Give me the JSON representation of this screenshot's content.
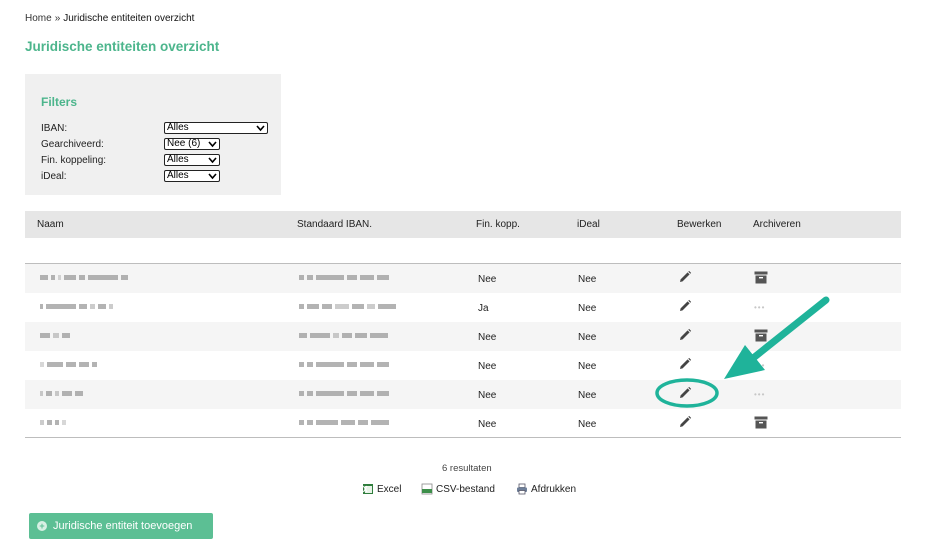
{
  "breadcrumb": {
    "home": "Home",
    "separator": "»",
    "current": "Juridische entiteiten overzicht"
  },
  "page_title": "Juridische entiteiten overzicht",
  "filters": {
    "title": "Filters",
    "items": [
      {
        "label": "IBAN:",
        "value": "Alles"
      },
      {
        "label": "Gearchiveerd:",
        "value": "Nee (6)"
      },
      {
        "label": "Fin. koppeling:",
        "value": "Alles"
      },
      {
        "label": "iDeal:",
        "value": "Alles"
      }
    ]
  },
  "table": {
    "headers": [
      "Naam",
      "Standaard IBAN.",
      "Fin. kopp.",
      "iDeal",
      "Bewerken",
      "Archiveren"
    ],
    "rows": [
      {
        "fin": "Nee",
        "ideal": "Nee",
        "archive": "archive-icon"
      },
      {
        "fin": "Ja",
        "ideal": "Nee",
        "archive": "dots"
      },
      {
        "fin": "Nee",
        "ideal": "Nee",
        "archive": "archive-icon"
      },
      {
        "fin": "Nee",
        "ideal": "Nee",
        "archive": "dots"
      },
      {
        "fin": "Nee",
        "ideal": "Nee",
        "archive": "dots"
      },
      {
        "fin": "Nee",
        "ideal": "Nee",
        "archive": "archive-icon"
      }
    ]
  },
  "results": "6 resultaten",
  "exports": {
    "excel": "Excel",
    "csv": "CSV-bestand",
    "print": "Afdrukken"
  },
  "add_button": "Juridische entiteit toevoegen",
  "colors": {
    "accent": "#4cb58c",
    "button": "#5cbf94",
    "annotation": "#1fb39a"
  }
}
